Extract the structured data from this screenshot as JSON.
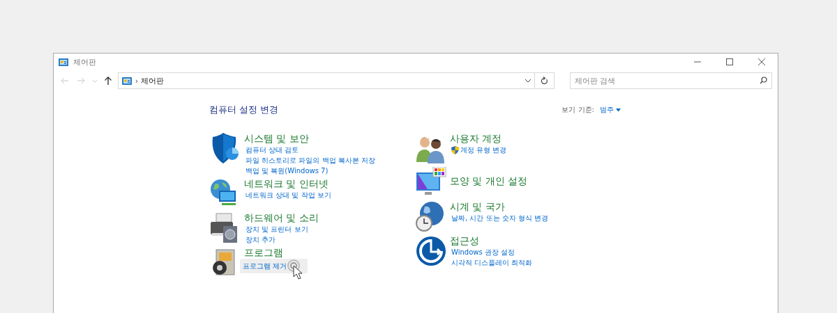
{
  "window": {
    "title": "제어판"
  },
  "address_bar": {
    "separator": "›",
    "path": "제어판"
  },
  "search": {
    "placeholder": "제어판 검색"
  },
  "heading": "컴퓨터 설정 변경",
  "view_by": {
    "label": "보기 기준:",
    "value": "범주"
  },
  "columns": [
    {
      "categories": [
        {
          "title": "시스템 및 보안",
          "links": [
            {
              "text": "컴퓨터 상태 검토",
              "shield": false,
              "hovered": false
            },
            {
              "text": "파일 히스토리로 파일의 백업 복사본 저장",
              "shield": false,
              "hovered": false
            },
            {
              "text": "백업 및 복원(Windows 7)",
              "shield": false,
              "hovered": false
            }
          ]
        },
        {
          "title": "네트워크 및 인터넷",
          "links": [
            {
              "text": "네트워크 상태 및 작업 보기",
              "shield": false,
              "hovered": false
            }
          ]
        },
        {
          "title": "하드웨어 및 소리",
          "links": [
            {
              "text": "장치 및 프린터 보기",
              "shield": false,
              "hovered": false
            },
            {
              "text": "장치 추가",
              "shield": false,
              "hovered": false
            }
          ]
        },
        {
          "title": "프로그램",
          "links": [
            {
              "text": "프로그램 제거",
              "shield": false,
              "hovered": true
            }
          ]
        }
      ]
    },
    {
      "categories": [
        {
          "title": "사용자 계정",
          "links": [
            {
              "text": "계정 유형 변경",
              "shield": true,
              "hovered": false
            }
          ]
        },
        {
          "title": "모양 및 개인 설정"
        },
        {
          "title": "시계 및 국가",
          "links": [
            {
              "text": "날짜, 시간 또는 숫자 형식 변경",
              "shield": false,
              "hovered": false
            }
          ]
        },
        {
          "title": "접근성",
          "links": [
            {
              "text": "Windows 권장 설정",
              "shield": false,
              "hovered": false
            },
            {
              "text": "시각적 디스플레이 최적화",
              "shield": false,
              "hovered": false
            }
          ]
        }
      ]
    }
  ]
}
